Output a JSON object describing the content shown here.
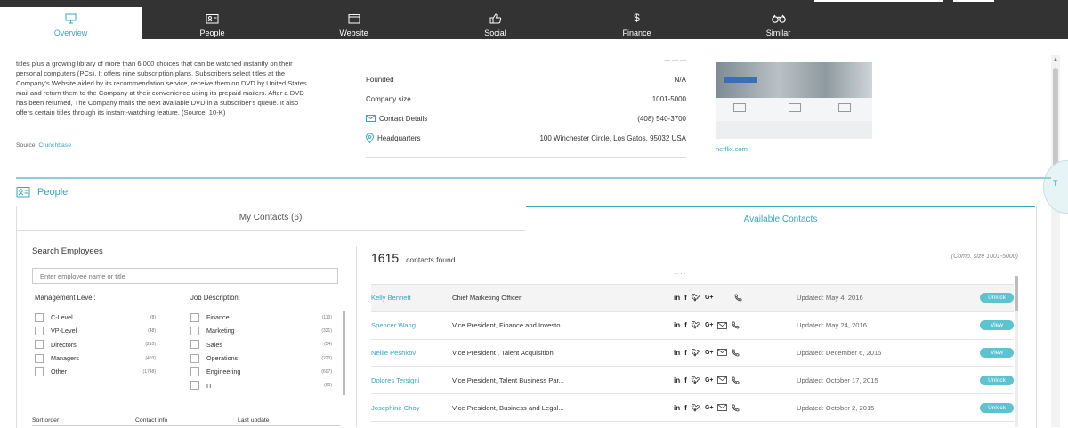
{
  "tabs": [
    {
      "label": "Overview",
      "icon": "monitor-icon",
      "active": true
    },
    {
      "label": "People",
      "icon": "contact-card-icon",
      "active": false
    },
    {
      "label": "Website",
      "icon": "browser-window-icon",
      "active": false
    },
    {
      "label": "Social",
      "icon": "thumbs-up-icon",
      "active": false
    },
    {
      "label": "Finance",
      "icon": "dollar-icon",
      "active": false
    },
    {
      "label": "Similar",
      "icon": "binoculars-icon",
      "active": false
    }
  ],
  "company": {
    "description_lines": [
      "titles plus a growing library of more than 6,000 choices that can be watched instantly on their",
      "personal computers (PCs). It offers nine subscription plans. Subscribers select titles at the",
      "Company's Website aided by its recommendation service, receive them on DVD by United States",
      "mail and return them to the Company at their convenience using its prepaid mailers. After a DVD",
      "has been returned, The Company mails the next available DVD in a subscriber's queue. It also",
      "offers certain titles through its instant-watching feature. (Source: 10-K)"
    ],
    "source_label": "Source:",
    "source_link": "Crunchbase",
    "info": [
      {
        "label": "Founded",
        "value": "N/A",
        "icon": ""
      },
      {
        "label": "Company size",
        "value": "1001-5000",
        "icon": ""
      },
      {
        "label": "Contact Details",
        "value": "(408) 540-3700",
        "icon": "envelope-icon"
      },
      {
        "label": "Headquarters",
        "value": "100 Winchester Circle, Los Gatos, 95032 USA",
        "icon": "map-pin-icon"
      }
    ],
    "website_link": "netflix.com"
  },
  "people": {
    "heading": "People",
    "tab_my_contacts": "My Contacts (6)",
    "tab_available": "Available Contacts",
    "search_title": "Search Employees",
    "search_placeholder": "Enter employee name or title",
    "management_title": "Management Level:",
    "management": [
      {
        "name": "C-Level",
        "count": "(8)"
      },
      {
        "name": "VP-Level",
        "count": "(48)"
      },
      {
        "name": "Directors",
        "count": "(210)"
      },
      {
        "name": "Managers",
        "count": "(403)"
      },
      {
        "name": "Other",
        "count": "(1748)"
      }
    ],
    "job_title": "Job Description:",
    "jobs": [
      {
        "name": "Finance",
        "count": "(110)"
      },
      {
        "name": "Marketing",
        "count": "(321)"
      },
      {
        "name": "Sales",
        "count": "(54)"
      },
      {
        "name": "Operations",
        "count": "(220)"
      },
      {
        "name": "Engineering",
        "count": "(607)"
      },
      {
        "name": "IT",
        "count": "(60)"
      }
    ],
    "sort_labels": [
      "Sort order",
      "Contact info",
      "Last update"
    ],
    "found_count": "1615",
    "found_label": "contacts found",
    "comp_size_prefix": "(Comp. size",
    "comp_size_value": "1001-5000",
    "comp_size_suffix": ")",
    "contacts": [
      {
        "name": "Kelly Bennett",
        "title": "Chief Marketing Officer",
        "email": false,
        "updated": "Updated: May 4, 2016",
        "action": "Unlock"
      },
      {
        "name": "Spencer Wang",
        "title": "Vice President, Finance and Investo...",
        "email": true,
        "updated": "Updated: May 24, 2016",
        "action": "View"
      },
      {
        "name": "Nellie Peshkov",
        "title": "Vice President , Talent Acquisition",
        "email": true,
        "updated": "Updated: December 6, 2015",
        "action": "View"
      },
      {
        "name": "Dolores Tersigni",
        "title": "Vice President, Talent Business Par...",
        "email": true,
        "updated": "Updated: October 17, 2015",
        "action": "Unlock"
      },
      {
        "name": "Josephine Choy",
        "title": "Vice President, Business and Legal...",
        "email": true,
        "updated": "Updated: October 2, 2015",
        "action": "Unlock"
      }
    ]
  },
  "colors": {
    "accent": "#3aa7b8",
    "topbar": "#333333",
    "button": "#5cc3cf"
  }
}
